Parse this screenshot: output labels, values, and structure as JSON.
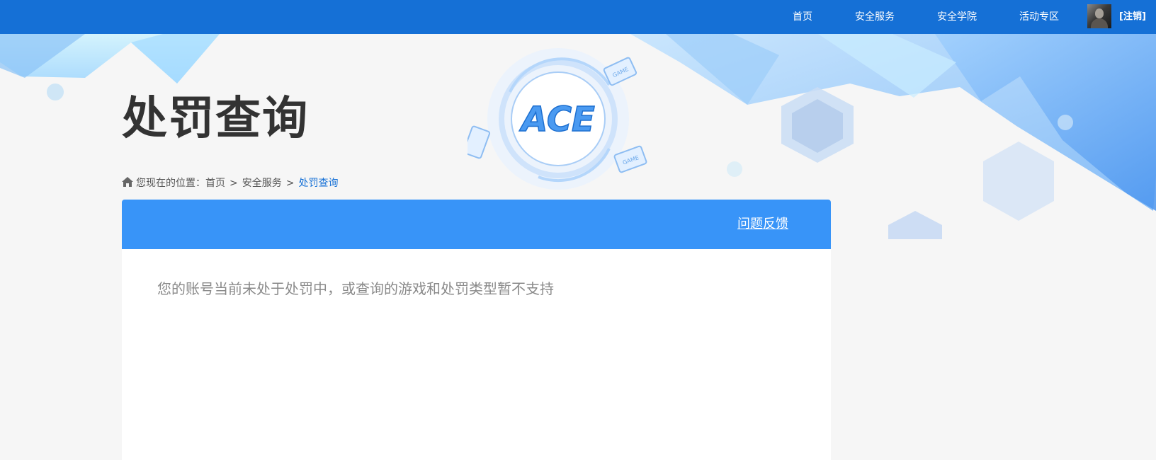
{
  "nav": {
    "items": [
      {
        "label": "首页"
      },
      {
        "label": "安全服务"
      },
      {
        "label": "安全学院"
      },
      {
        "label": "活动专区"
      }
    ],
    "logout_label": "[注销]"
  },
  "banner": {
    "title": "处罚查询",
    "emblem_text": "ACE",
    "game_tag": "GAME"
  },
  "breadcrumb": {
    "prefix": "您现在的位置：",
    "items": [
      "首页",
      "安全服务"
    ],
    "separator": ">",
    "current": "处罚查询"
  },
  "panel": {
    "feedback_label": "问题反馈",
    "notice": "您的账号当前未处于处罚中，或查询的游戏和处罚类型暂不支持"
  },
  "colors": {
    "nav_bg": "#1570d6",
    "panel_header": "#3894f8",
    "title_text": "#333333",
    "notice_text": "#8a8a8a"
  }
}
